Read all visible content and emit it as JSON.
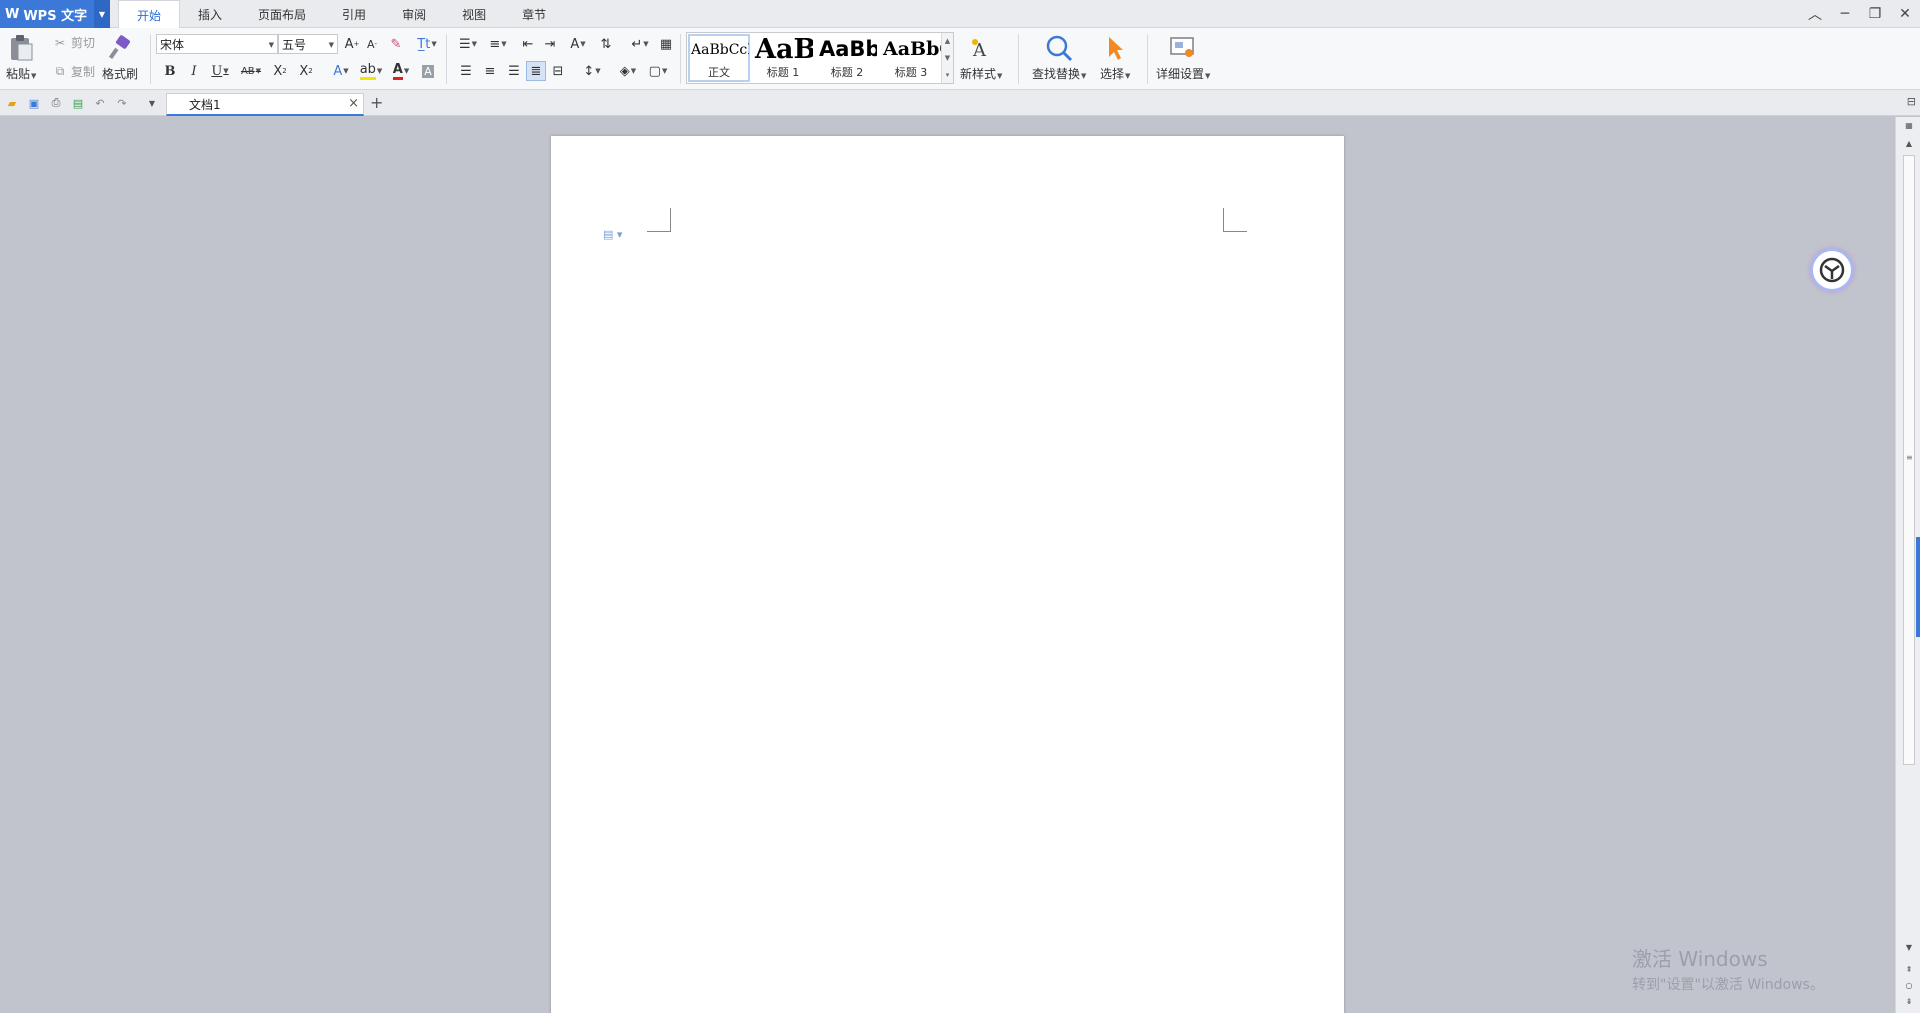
{
  "app": {
    "name": "WPS 文字",
    "logo": "W"
  },
  "menu_tabs": [
    {
      "label": "开始",
      "active": true
    },
    {
      "label": "插入",
      "active": false
    },
    {
      "label": "页面布局",
      "active": false
    },
    {
      "label": "引用",
      "active": false
    },
    {
      "label": "审阅",
      "active": false
    },
    {
      "label": "视图",
      "active": false
    },
    {
      "label": "章节",
      "active": false
    }
  ],
  "clipboard": {
    "paste": "粘贴",
    "cut": "剪切",
    "copy": "复制",
    "format_painter": "格式刷"
  },
  "font": {
    "family": "宋体",
    "size": "五号"
  },
  "styles": [
    {
      "sample": "AaBbCcD",
      "name": "正文"
    },
    {
      "sample": "AaB",
      "name": "标题 1"
    },
    {
      "sample": "AaBb(",
      "name": "标题 2"
    },
    {
      "sample": "AaBbC",
      "name": "标题 3"
    }
  ],
  "actions": {
    "new_style": "新样式",
    "find_replace": "查找替换",
    "select": "选择",
    "detail_settings": "详细设置"
  },
  "document_tab": {
    "title": "文档1"
  },
  "watermark": {
    "line1": "激活 Windows",
    "line2": "转到\"设置\"以激活 Windows。"
  },
  "colors": {
    "accent": "#3c78d8",
    "ribbon_bg": "#f7f8fa",
    "canvas_bg": "#c1c4cc"
  }
}
